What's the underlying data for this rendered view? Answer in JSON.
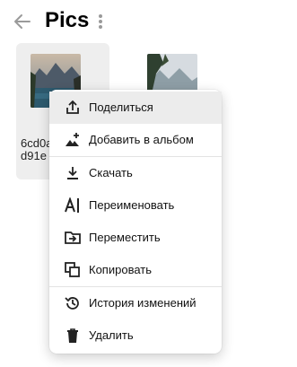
{
  "header": {
    "title": "Pics",
    "back_icon": "arrow-left-icon",
    "more_icon": "more-vertical-icon"
  },
  "files": [
    {
      "name_line1": "6cd0a",
      "name_line2": "d91e",
      "thumb": "mountain-lake-photo"
    },
    {
      "name_line1": "",
      "name_line2": "",
      "thumb": "valley-lake-photo"
    }
  ],
  "context_menu": {
    "items": [
      {
        "label": "Поделиться",
        "icon": "share-icon"
      },
      {
        "label": "Добавить в альбом",
        "icon": "add-to-album-icon"
      },
      {
        "label": "Скачать",
        "icon": "download-icon"
      },
      {
        "label": "Переименовать",
        "icon": "rename-icon"
      },
      {
        "label": "Переместить",
        "icon": "move-icon"
      },
      {
        "label": "Копировать",
        "icon": "copy-icon"
      },
      {
        "label": "История изменений",
        "icon": "history-icon"
      },
      {
        "label": "Удалить",
        "icon": "delete-icon"
      }
    ]
  },
  "colors": {
    "accent_icon": "#222222",
    "hover_bg": "#ececec",
    "selected_tile_bg": "#eeeeee"
  }
}
